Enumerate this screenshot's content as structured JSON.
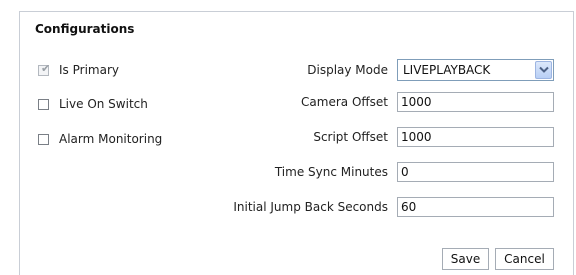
{
  "section": {
    "title": "Configurations"
  },
  "checkboxes": [
    {
      "label": "Is Primary",
      "checked": true,
      "disabled": true
    },
    {
      "label": "Live On Switch",
      "checked": false,
      "disabled": false
    },
    {
      "label": "Alarm Monitoring",
      "checked": false,
      "disabled": false
    }
  ],
  "fields": {
    "display_mode": {
      "label": "Display Mode",
      "value": "LIVEPLAYBACK"
    },
    "camera_offset": {
      "label": "Camera Offset",
      "value": "1000"
    },
    "script_offset": {
      "label": "Script Offset",
      "value": "1000"
    },
    "time_sync_minutes": {
      "label": "Time Sync Minutes",
      "value": "0"
    },
    "initial_jump_back_seconds": {
      "label": "Initial Jump Back Seconds",
      "value": "60"
    }
  },
  "buttons": {
    "save": "Save",
    "cancel": "Cancel"
  },
  "icons": {
    "dropdown": "chevron-down-icon",
    "check": "check-icon"
  },
  "colors": {
    "panel_border": "#c9ced6",
    "input_border": "#a5acb5",
    "select_arrow": "#4d6185"
  }
}
